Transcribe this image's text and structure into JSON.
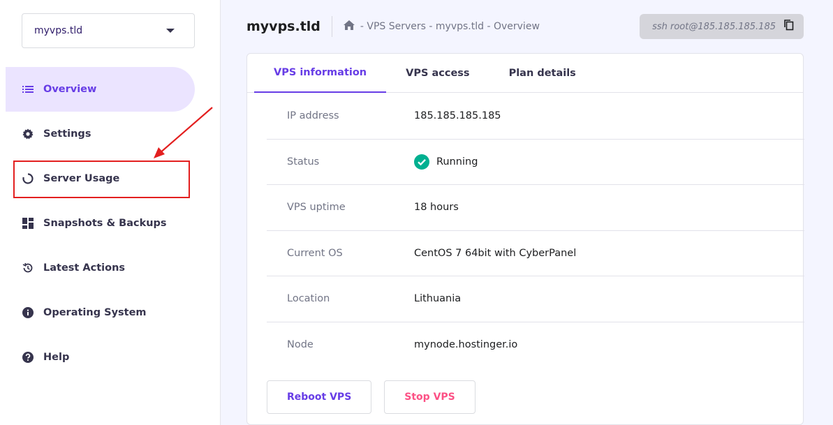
{
  "server_select": {
    "value": "myvps.tld"
  },
  "sidebar": {
    "items": [
      {
        "label": "Overview",
        "icon": "list-icon"
      },
      {
        "label": "Settings",
        "icon": "gear-icon"
      },
      {
        "label": "Server Usage",
        "icon": "ring-icon"
      },
      {
        "label": "Snapshots & Backups",
        "icon": "grid-icon"
      },
      {
        "label": "Latest Actions",
        "icon": "history-icon"
      },
      {
        "label": "Operating System",
        "icon": "info-icon"
      },
      {
        "label": "Help",
        "icon": "question-icon"
      }
    ]
  },
  "header": {
    "title": "myvps.tld",
    "breadcrumb": "- VPS Servers - myvps.tld - Overview",
    "ssh_command": "ssh root@185.185.185.185"
  },
  "tabs": [
    {
      "label": "VPS information"
    },
    {
      "label": "VPS access"
    },
    {
      "label": "Plan details"
    }
  ],
  "info": {
    "rows": [
      {
        "label": "IP address",
        "value": "185.185.185.185"
      },
      {
        "label": "Status",
        "value": "Running"
      },
      {
        "label": "VPS uptime",
        "value": "18 hours"
      },
      {
        "label": "Current OS",
        "value": "CentOS 7 64bit with CyberPanel"
      },
      {
        "label": "Location",
        "value": "Lithuania"
      },
      {
        "label": "Node",
        "value": "mynode.hostinger.io"
      }
    ]
  },
  "actions": {
    "reboot_label": "Reboot VPS",
    "stop_label": "Stop VPS"
  },
  "colors": {
    "accent": "#673de6",
    "accent_light": "#ebe4ff",
    "status_ok": "#00b090",
    "danger": "#fc5185",
    "annotation": "#e31f1f"
  }
}
